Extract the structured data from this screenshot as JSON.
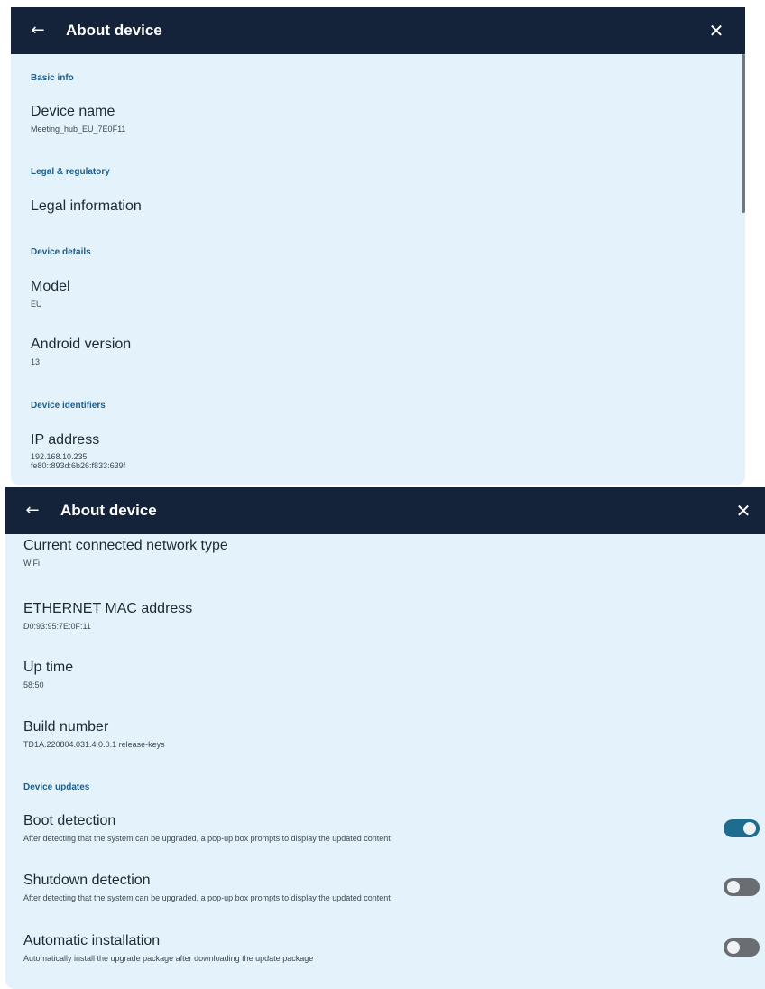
{
  "top_panel": {
    "title": "About device",
    "back_icon": "arrow-left-icon",
    "close_icon": "close-icon",
    "sections": {
      "basic_info": "Basic info",
      "legal": "Legal & regulatory",
      "device_details": "Device details",
      "device_identifiers": "Device identifiers"
    },
    "items": {
      "device_name": {
        "title": "Device name",
        "value": "Meeting_hub_EU_7E0F11"
      },
      "legal_information": {
        "title": "Legal information"
      },
      "model": {
        "title": "Model",
        "value": "EU"
      },
      "android_version": {
        "title": "Android version",
        "value": "13"
      },
      "ip_address": {
        "title": "IP address",
        "value_line1": "192.168.10.235",
        "value_line2": "fe80::893d:6b26:f833:639f"
      }
    }
  },
  "bottom_panel": {
    "title": "About device",
    "back_icon": "arrow-left-icon",
    "close_icon": "close-icon",
    "items": {
      "network_type": {
        "title": "Current connected network type",
        "value": "WiFi"
      },
      "ethernet_mac": {
        "title": "ETHERNET MAC address",
        "value": "D0:93:95:7E:0F:11"
      },
      "up_time": {
        "title": "Up time",
        "value": "58:50"
      },
      "build_number": {
        "title": "Build number",
        "value": "TD1A.220804.031.4.0.0.1 release-keys"
      }
    },
    "sections": {
      "device_updates": "Device updates"
    },
    "toggles": {
      "boot_detection": {
        "title": "Boot detection",
        "description": "After detecting that the system can be upgraded, a pop-up box prompts to display the updated content",
        "on": true
      },
      "shutdown_detection": {
        "title": "Shutdown detection",
        "description": "After detecting that the system can be upgraded, a pop-up box prompts to display the updated content",
        "on": false
      },
      "automatic_installation": {
        "title": "Automatic installation",
        "description": "Automatically install the upgrade package after downloading the update package",
        "on": false
      }
    }
  },
  "colors": {
    "titlebar": "#14233a",
    "panel_bg": "#e4f2fb",
    "section_text": "#1d5f8a",
    "toggle_on": "#1e6d8f",
    "toggle_off": "#6a6e72"
  }
}
